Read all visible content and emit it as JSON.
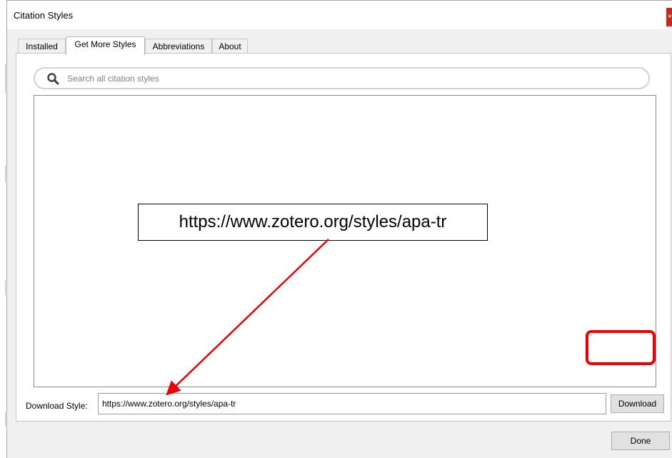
{
  "window": {
    "title": "Citation Styles",
    "close_label": "×"
  },
  "tabs": [
    {
      "label": "Installed",
      "active": false
    },
    {
      "label": "Get More Styles",
      "active": true
    },
    {
      "label": "Abbreviations",
      "active": false
    },
    {
      "label": "About",
      "active": false
    }
  ],
  "search": {
    "placeholder": "Search all citation styles",
    "value": ""
  },
  "download": {
    "label": "Download Style:",
    "value": "https://www.zotero.org/styles/apa-tr",
    "button_label": "Download"
  },
  "footer": {
    "done_label": "Done"
  },
  "annotation": {
    "callout_text": "https://www.zotero.org/styles/apa-tr",
    "highlight_color": "#ee0000",
    "arrow_color": "#ee0000"
  }
}
